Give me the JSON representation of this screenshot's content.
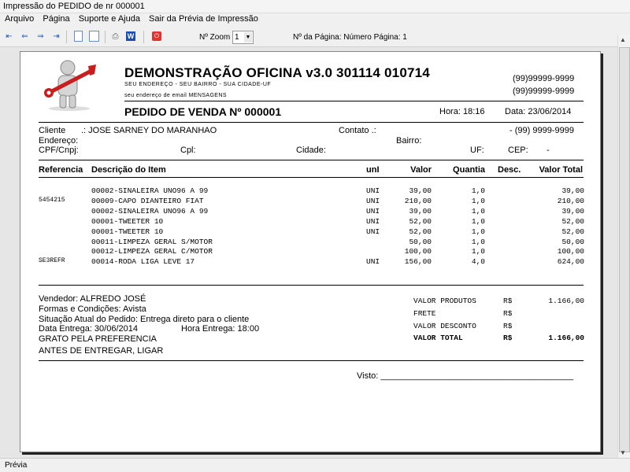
{
  "window": {
    "title": "Impressão do PEDIDO de nr 000001"
  },
  "menu": [
    "Arquivo",
    "Página",
    "Suporte e Ajuda",
    "Sair da Prévia de Impressão"
  ],
  "toolbar": {
    "zoom_label": "Nº Zoom",
    "zoom_value": "1",
    "page_label": "Nº da Página: Número Página: 1",
    "icons": [
      "first-page-icon",
      "prev-page-icon",
      "next-page-icon",
      "last-page-icon",
      "single-page-icon",
      "two-pages-icon",
      "print-icon",
      "word-export-icon",
      "pdf-export-icon"
    ]
  },
  "status": {
    "text": "Prévia"
  },
  "report": {
    "company": "DEMONSTRAÇÃO OFICINA v3.0 301114 010714",
    "address": "SEU ENDEREÇO - SEU BAIRRO - SUA CIDADE-UF",
    "email": "seu endereço de email MENSAGENS",
    "phone1": "(99)99999-9999",
    "phone2": "(99)99999-9999",
    "order_title": "PEDIDO DE VENDA Nº 000001",
    "hora": "Hora: 18:16",
    "data": "Data: 23/06/2014",
    "client_label": "Cliente",
    "client_value": ".: JOSE SARNEY DO MARANHAO",
    "contato_label": "Contato .:",
    "contato_value": "- (99) 9999-9999",
    "endereco_label": "Endereço:",
    "bairro_label": "Bairro:",
    "cpf_label": "CPF/Cnpj:",
    "cpl_label": "Cpl:",
    "cidade_label": "Cidade:",
    "uf_label": "UF:",
    "cep_label": "CEP:",
    "cep_value": "-",
    "columns": [
      "Referencia",
      "Descrição do Item",
      "unI",
      "Valor",
      "Quantia",
      "Desc.",
      "Valor Total"
    ],
    "items": [
      {
        "ref": "",
        "desc": "00002-SINALEIRA UNO96 A 99",
        "un": "UNI",
        "valor": "39,00",
        "qtd": "1,0",
        "desc_pct": "",
        "total": "39,00"
      },
      {
        "ref": "5454215",
        "desc": "00009-CAPO DIANTEIRO FIAT",
        "un": "UNI",
        "valor": "210,00",
        "qtd": "1,0",
        "desc_pct": "",
        "total": "210,00"
      },
      {
        "ref": "",
        "desc": "00002-SINALEIRA UNO96 A 99",
        "un": "UNI",
        "valor": "39,00",
        "qtd": "1,0",
        "desc_pct": "",
        "total": "39,00"
      },
      {
        "ref": "",
        "desc": "00001-TWEETER 10",
        "un": "UNI",
        "valor": "52,00",
        "qtd": "1,0",
        "desc_pct": "",
        "total": "52,00"
      },
      {
        "ref": "",
        "desc": "00001-TWEETER 10",
        "un": "UNI",
        "valor": "52,00",
        "qtd": "1,0",
        "desc_pct": "",
        "total": "52,00"
      },
      {
        "ref": "",
        "desc": "00011-LIMPEZA GERAL S/MOTOR",
        "un": "",
        "valor": "50,00",
        "qtd": "1,0",
        "desc_pct": "",
        "total": "50,00"
      },
      {
        "ref": "",
        "desc": "00012-LIMPEZA GERAL C/MOTOR",
        "un": "",
        "valor": "100,00",
        "qtd": "1,0",
        "desc_pct": "",
        "total": "100,00"
      },
      {
        "ref": "SE3REFR",
        "desc": "00014-RODA LIGA LEVE 17",
        "un": "UNI",
        "valor": "156,00",
        "qtd": "4,0",
        "desc_pct": "",
        "total": "624,00"
      }
    ],
    "vendedor": "Vendedor: ALFREDO JOSÉ",
    "formas": "Formas e Condições: Avista",
    "situacao": "Situação Atual do Pedido: Entrega direto para o cliente",
    "data_entrega": "Data Entrega: 30/06/2014",
    "hora_entrega": "Hora Entrega: 18:00",
    "msg1": "GRATO PELA PREFERENCIA",
    "msg2": "ANTES DE ENTREGAR, LIGAR",
    "totals": {
      "produtos_label": "VALOR PRODUTOS",
      "produtos_cur": "R$",
      "produtos_value": "1.166,00",
      "frete_label": "FRETE",
      "frete_cur": "R$",
      "desconto_label": "VALOR DESCONTO",
      "desconto_cur": "R$",
      "total_label": "VALOR TOTAL",
      "total_cur": "R$",
      "total_value": "1.166,00"
    },
    "visto": "Visto: ________________________________________"
  }
}
